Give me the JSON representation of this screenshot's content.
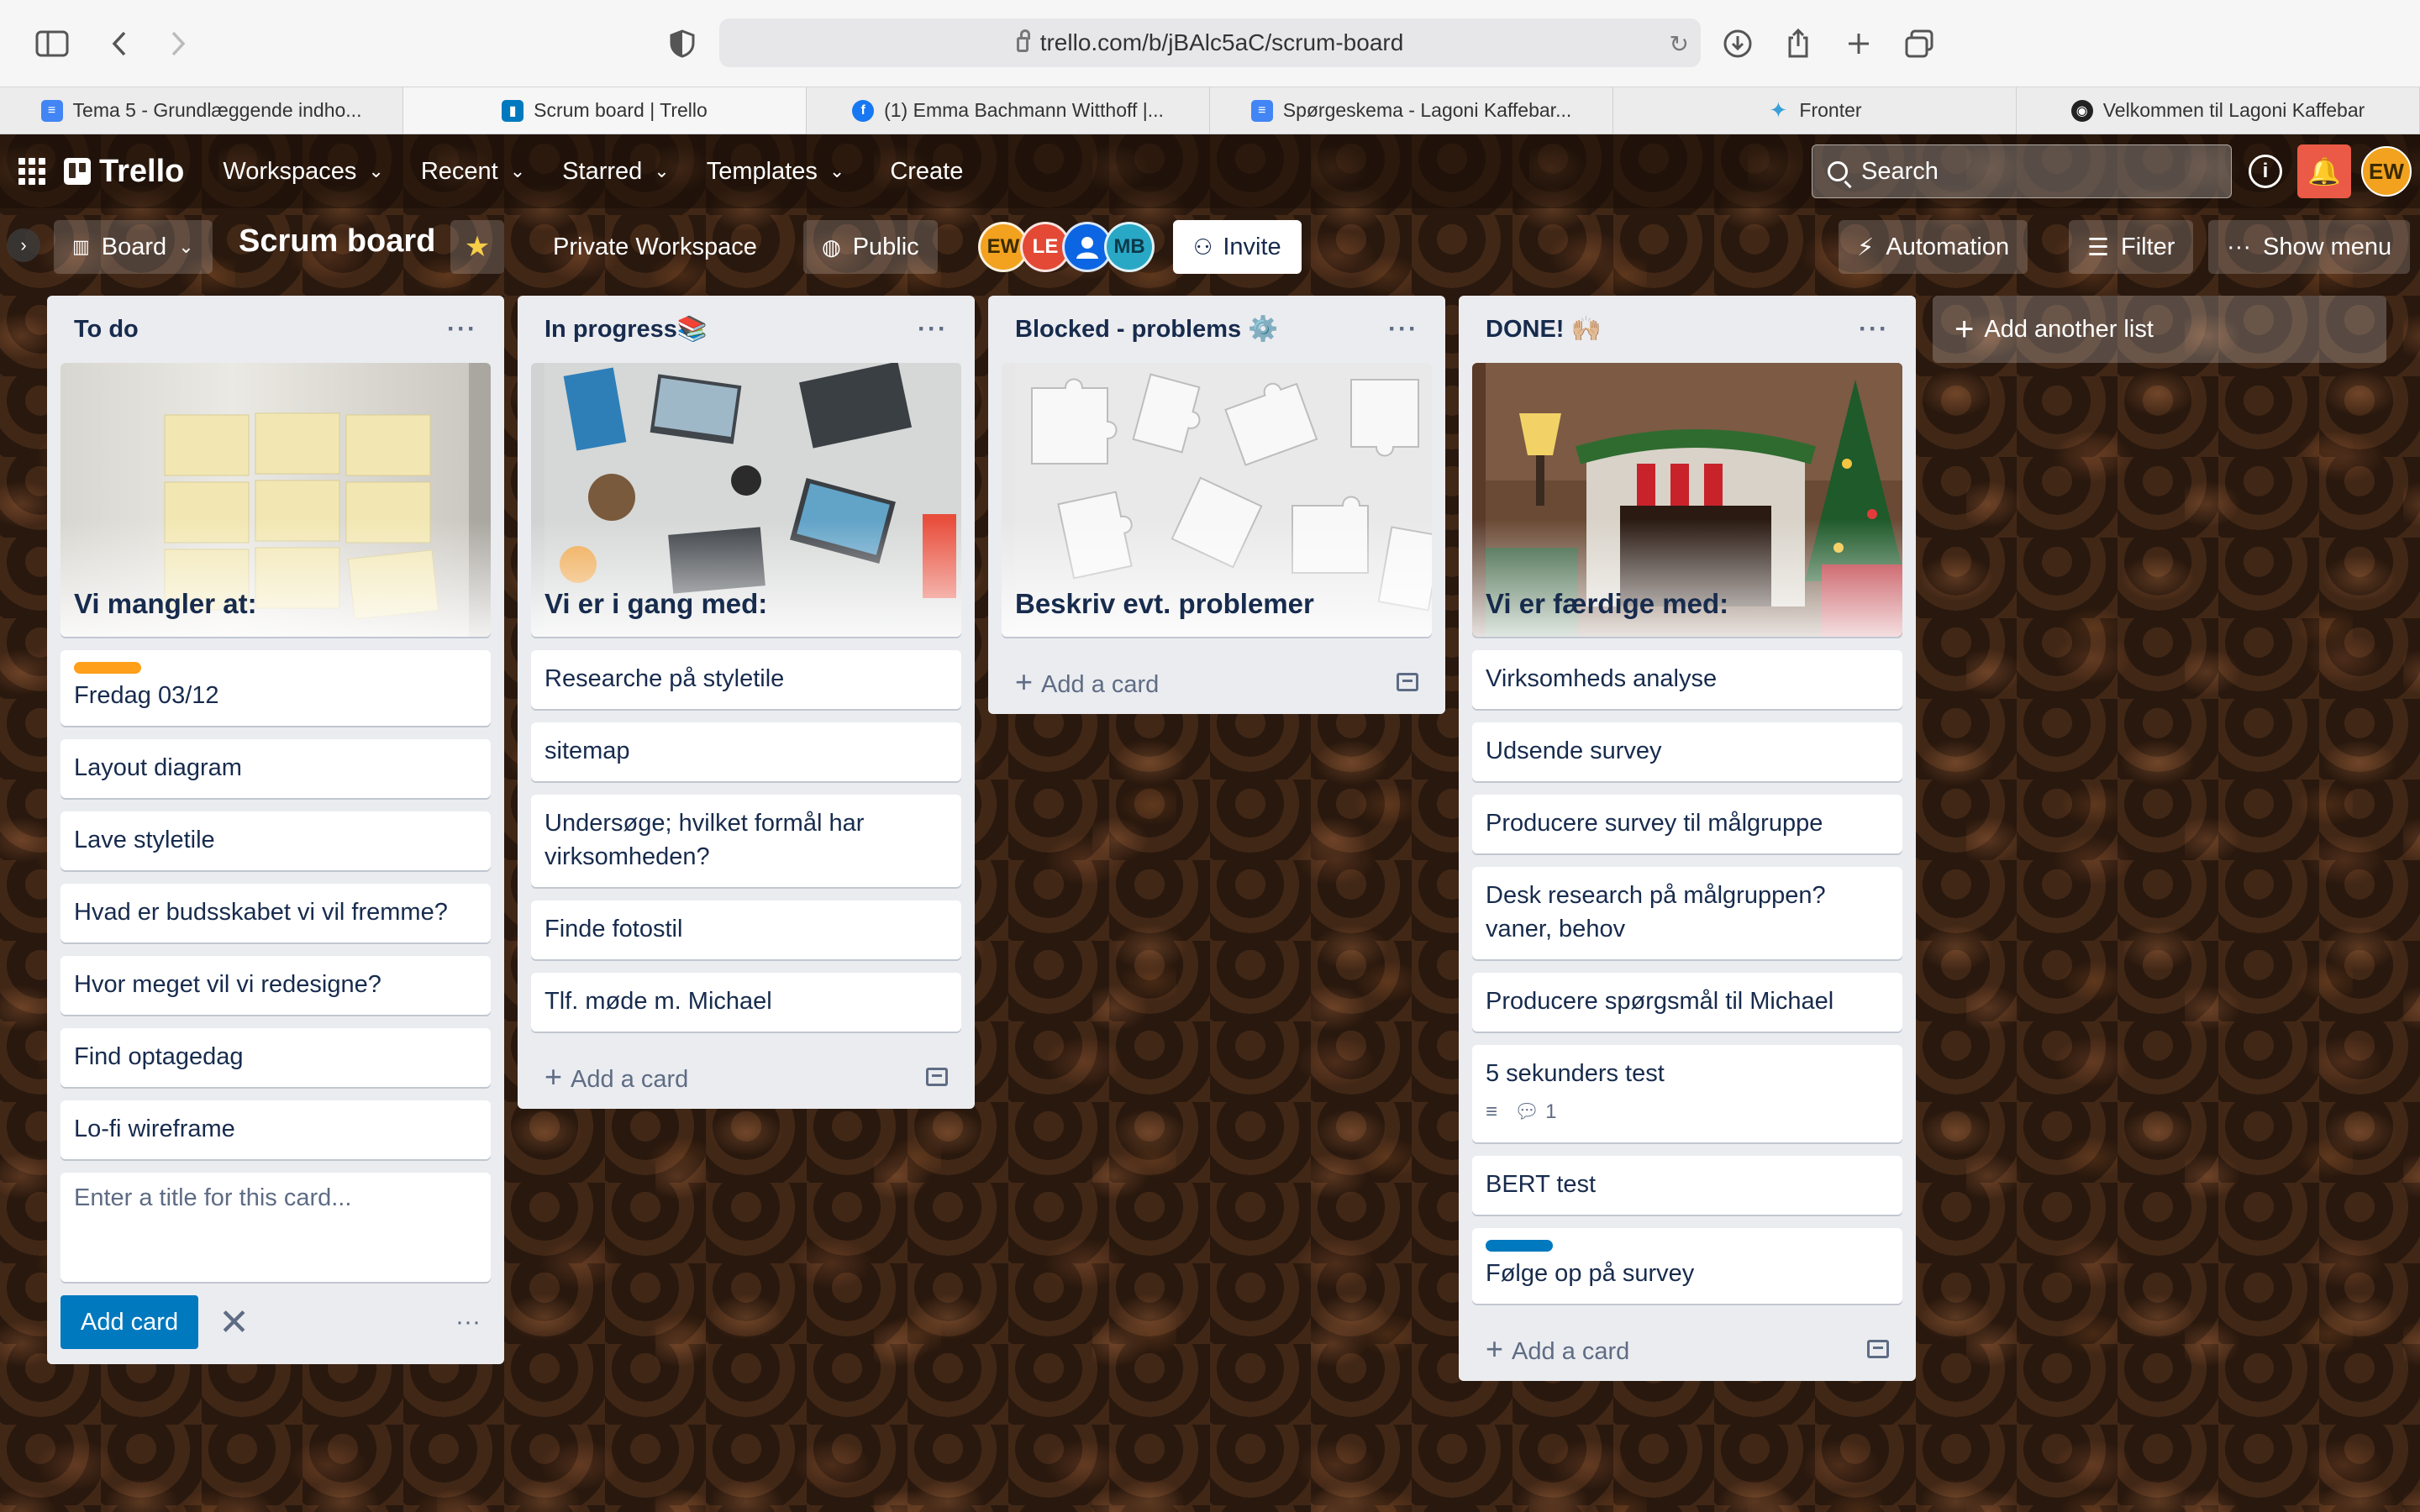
{
  "browser": {
    "url": "trello.com/b/jBAlc5aC/scrum-board",
    "tabs": [
      {
        "title": "Tema 5 - Grundlæggende indho...",
        "icon": "docs-icon",
        "color": "#4285f4",
        "active": false
      },
      {
        "title": "Scrum board | Trello",
        "icon": "trello-icon",
        "color": "#0079bf",
        "active": true
      },
      {
        "title": "(1) Emma Bachmann Witthoff |...",
        "icon": "facebook-icon",
        "color": "#1877f2",
        "active": false
      },
      {
        "title": "Spørgeskema - Lagoni Kaffebar...",
        "icon": "forms-icon",
        "color": "#4285f4",
        "active": false
      },
      {
        "title": "Fronter",
        "icon": "fronter-icon",
        "color": "#3aa0d8",
        "active": false
      },
      {
        "title": "Velkommen til Lagoni Kaffebar",
        "icon": "site-icon",
        "color": "#222222",
        "active": false
      }
    ]
  },
  "header": {
    "logo": "Trello",
    "nav": [
      "Workspaces",
      "Recent",
      "Starred",
      "Templates"
    ],
    "create": "Create",
    "search_placeholder": "Search",
    "avatar": "EW"
  },
  "board": {
    "view": "Board",
    "title": "Scrum board",
    "workspace": "Private Workspace",
    "visibility": "Public",
    "members": [
      {
        "initials": "EW",
        "color": "#f2a21f"
      },
      {
        "initials": "LE",
        "color": "#e34935"
      },
      {
        "initials": "",
        "color": "#0c66e4"
      },
      {
        "initials": "MB",
        "color": "#29a8c6"
      }
    ],
    "invite": "Invite",
    "automation": "Automation",
    "filter": "Filter",
    "show_menu": "Show menu",
    "add_list": "Add another list"
  },
  "lists": [
    {
      "title": "To do",
      "cover_title": "Vi mangler at:",
      "cards": [
        {
          "text": "Fredag 03/12",
          "label_color": "#ff9f1a"
        },
        {
          "text": "Layout diagram"
        },
        {
          "text": "Lave styletile"
        },
        {
          "text": "Hvad er budsskabet vi vil fremme?"
        },
        {
          "text": "Hvor meget vil vi redesigne?"
        },
        {
          "text": "Find optagedag"
        },
        {
          "text": "Lo-fi wireframe"
        }
      ],
      "composer_placeholder": "Enter a title for this card...",
      "add_card_button": "Add card"
    },
    {
      "title": "In progress📚",
      "cover_title": "Vi er i gang med:",
      "cards": [
        {
          "text": "Researche på styletile"
        },
        {
          "text": "sitemap"
        },
        {
          "text": "Undersøge; hvilket formål har virksomheden?"
        },
        {
          "text": "Finde fotostil"
        },
        {
          "text": "Tlf. møde m. Michael"
        }
      ],
      "add_card": "Add a card"
    },
    {
      "title": "Blocked - problems ⚙️",
      "cover_title": "Beskriv evt. problemer",
      "cards": [],
      "add_card": "Add a card"
    },
    {
      "title": "DONE! 🙌🏼",
      "cover_title": "Vi er færdige med:",
      "cards": [
        {
          "text": "Virksomheds analyse"
        },
        {
          "text": "Udsende survey"
        },
        {
          "text": "Producere survey til målgruppe"
        },
        {
          "text": "Desk research på målgruppen? vaner, behov"
        },
        {
          "text": "Producere spørgsmål til Michael"
        },
        {
          "text": "5 sekunders test",
          "comments": "1"
        },
        {
          "text": "BERT test"
        },
        {
          "text": "Følge op på survey",
          "label_color": "#0079bf"
        }
      ],
      "add_card": "Add a card"
    }
  ]
}
